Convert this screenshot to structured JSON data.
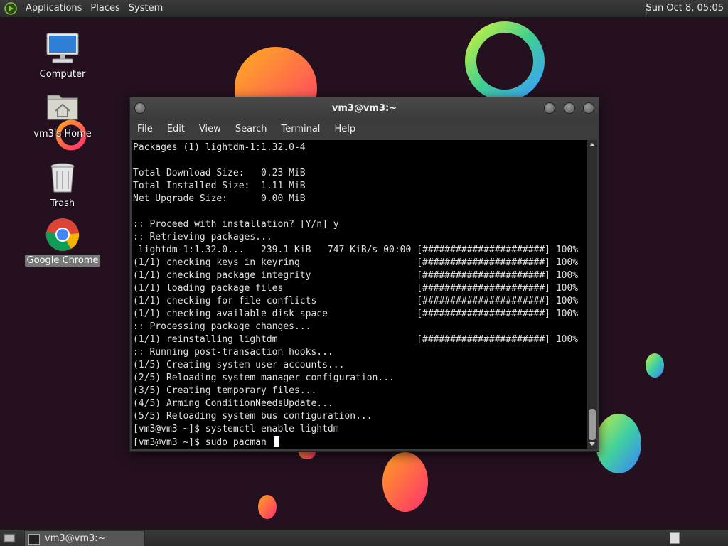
{
  "top_panel": {
    "menus": [
      "Applications",
      "Places",
      "System"
    ],
    "clock": "Sun Oct  8, 05:05"
  },
  "desktop_icons": [
    {
      "label": "Computer",
      "icon": "computer-icon"
    },
    {
      "label": "vm3's Home",
      "icon": "home-folder-icon"
    },
    {
      "label": "Trash",
      "icon": "trash-icon"
    },
    {
      "label": "Google Chrome",
      "icon": "chrome-icon",
      "selected": true
    }
  ],
  "terminal": {
    "title": "vm3@vm3:~",
    "menu": [
      "File",
      "Edit",
      "View",
      "Search",
      "Terminal",
      "Help"
    ],
    "lines": [
      "Packages (1) lightdm-1:1.32.0-4",
      "",
      "Total Download Size:   0.23 MiB",
      "Total Installed Size:  1.11 MiB",
      "Net Upgrade Size:      0.00 MiB",
      "",
      ":: Proceed with installation? [Y/n] y",
      ":: Retrieving packages...",
      " lightdm-1:1.32.0...   239.1 KiB   747 KiB/s 00:00 [######################] 100%",
      "(1/1) checking keys in keyring                     [######################] 100%",
      "(1/1) checking package integrity                   [######################] 100%",
      "(1/1) loading package files                        [######################] 100%",
      "(1/1) checking for file conflicts                  [######################] 100%",
      "(1/1) checking available disk space                [######################] 100%",
      ":: Processing package changes...",
      "(1/1) reinstalling lightdm                         [######################] 100%",
      ":: Running post-transaction hooks...",
      "(1/5) Creating system user accounts...",
      "(2/5) Reloading system manager configuration...",
      "(3/5) Creating temporary files...",
      "(4/5) Arming ConditionNeedsUpdate...",
      "(5/5) Reloading system bus configuration...",
      "[vm3@vm3 ~]$ systemctl enable lightdm"
    ],
    "prompt": "[vm3@vm3 ~]$ ",
    "input": "sudo pacman "
  },
  "taskbar": {
    "window_label": "vm3@vm3:~"
  },
  "colors": {
    "desktop_bg": "#24101f",
    "panel_bg": "#333333",
    "terminal_bg": "#000000",
    "terminal_fg": "#e0e0e0"
  }
}
